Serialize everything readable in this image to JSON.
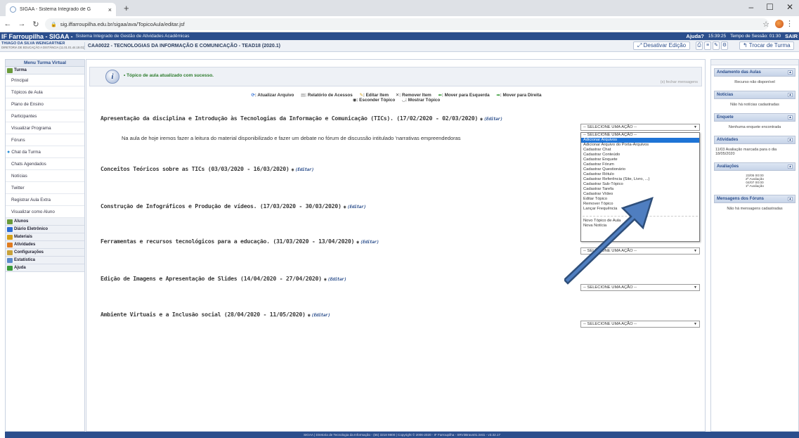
{
  "browser": {
    "tab_title": "SIGAA - Sistema Integrado de G",
    "tab_close": "×",
    "new_tab": "+",
    "url": "sig.iffarroupilha.edu.br/sigaa/ava/TopicoAula/editar.jsf",
    "window_controls": [
      "–",
      "☐",
      "✕"
    ]
  },
  "appbar": {
    "brand": "IF Farroupilha - SIGAA -",
    "subtitle": "Sistema Integrado de Gestão de Atividades Acadêmicas",
    "ajuda": "Ajuda?",
    "time": "15:39:25",
    "session_label": "Tempo de Sessão: 01:30",
    "sair": "SAIR"
  },
  "user": {
    "name": "THIAGO DA SILVA WEINGARTNER",
    "org": "DIRETORIA DE EDUCAÇÃO A DISTÂNCIA (11.01.01.44.18.01)"
  },
  "course": {
    "title": "CAA0022 - TECNOLOGIAS DA INFORMAÇÃO E COMUNICAÇÃO - TEAD18 (2020.1)"
  },
  "actions": {
    "desativar": "⤢ Desativar Edição",
    "trocar": "↰ Trocar de Turma"
  },
  "left_menu": {
    "header": "Menu Turma Virtual",
    "turma_label": "Turma",
    "turma_items": [
      "Principal",
      "Tópicos de Aula",
      "Plano de Ensino",
      "Participantes",
      "Visualizar Programa",
      "Fóruns",
      "Chat da Turma",
      "Chats Agendados",
      "Notícias",
      "Twitter",
      "Registrar Aula Extra",
      "Visualizar como Aluno"
    ],
    "groups": [
      "Alunos",
      "Diário Eletrônico",
      "Materiais",
      "Atividades",
      "Configurações",
      "Estatística",
      "Ajuda"
    ]
  },
  "message": {
    "text": "• Tópico de aula atualizado com sucesso.",
    "close": "(x) fechar mensagens"
  },
  "legend": {
    "line1": [
      "Atualizar Arquivo",
      "Relatório de Acessos",
      "Editar Item",
      "Remover Item",
      "Mover para Esquerda",
      "Mover para Direita"
    ],
    "line2": [
      "Esconder Tópico",
      "Mostrar Tópico"
    ]
  },
  "topics": [
    {
      "title": "Apresentação da disciplina e Introdução às Tecnologias da Informação e Comunicação (TICs). (17/02/2020 - 02/03/2020)",
      "body": "Na aula de hoje iremos fazer a leitura do material disponibilizado e fazer um debate no fórum de discussão intitulado 'narrativas empreendedoras"
    },
    {
      "title": "Conceitos Teóricos sobre as TICs (03/03/2020 - 16/03/2020)",
      "body": ""
    },
    {
      "title": "Construção de Infográficos e Produção de vídeos. (17/03/2020 - 30/03/2020)",
      "body": ""
    },
    {
      "title": "Ferramentas e recursos tecnológicos para a educação. (31/03/2020 - 13/04/2020)",
      "body": ""
    },
    {
      "title": "Edição de Imagens e Apresentação de Slides (14/04/2020 - 27/04/2020)",
      "body": ""
    },
    {
      "title": "Ambiente Virtuais e a Inclusão social (28/04/2020 - 11/05/2020)",
      "body": ""
    }
  ],
  "editar_label": "(Editar)",
  "select_default": "-- SELECIONE UMA AÇÃO --",
  "dropdown_options": [
    "-- SELECIONE UMA AÇÃO --",
    "Adicionar Arquivos",
    "Adicionar Arquivo do Porta-Arquivos",
    "Cadastrar Chat",
    "Cadastrar Conteúdo",
    "Cadastrar Enquete",
    "Cadastrar Fórum",
    "Cadastrar Questionário",
    "Cadastrar Rótulo",
    "Cadastrar Referência (Site, Livro, ...)",
    "Cadastrar Sub-Tópico",
    "Cadastrar Tarefa",
    "Cadastrar Vídeo",
    "Editar Tópico",
    "Remover Tópico",
    "Lançar Frequência",
    "Novo Tópico de Aula",
    "Nova Notícia"
  ],
  "right_panels": [
    {
      "title": "Andamento das Aulas",
      "body": "Recurso não disponível"
    },
    {
      "title": "Notícias",
      "body": "Não há notícias cadastradas"
    },
    {
      "title": "Enquete",
      "body": "Nenhuma enquete encontrada"
    },
    {
      "title": "Atividades",
      "body": "11/03 Avaliação marcada para o dia 18/05/2020"
    },
    {
      "title": "Avaliações",
      "body_lines": [
        "23/05 00:00",
        "2ª Avaliação",
        "04/07 00:00",
        "1ª Avaliação"
      ]
    },
    {
      "title": "Mensagens dos Fóruns",
      "body": "Não há mensagens cadastradas"
    }
  ],
  "footer": "SIGAA | Diretoria de Tecnologia da Informação - (55) 3218 9800 | Copyright © 2006-2020 - IF Farroupilha - SRV3Bravo01.inst1 - v3.32.17"
}
